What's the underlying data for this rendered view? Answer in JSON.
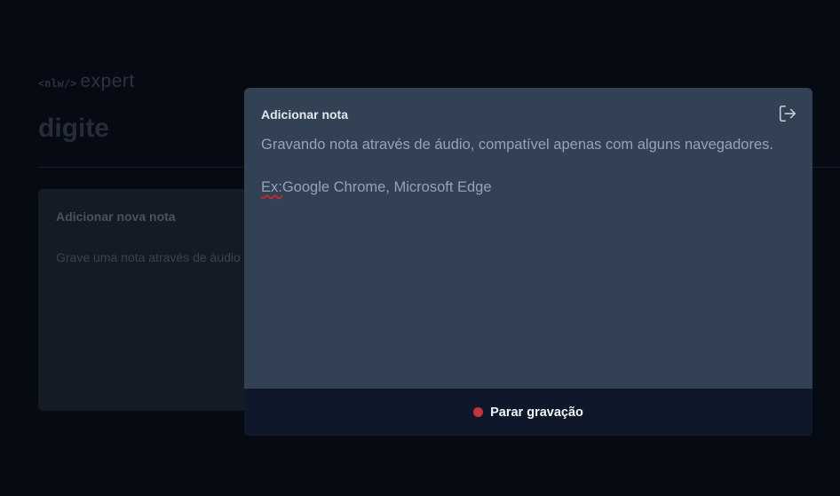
{
  "app": {
    "logo_code": "<nlw/>",
    "logo_word": "expert",
    "search_value": "digite"
  },
  "add_card": {
    "title": "Adicionar nova nota",
    "text": "Grave uma nota através de áudio ou utilize texto."
  },
  "modal": {
    "title": "Adicionar nota",
    "line1": "Gravando nota através de áudio, compatível apenas com alguns navegadores.",
    "ex_prefix": "Ex:",
    "ex_rest": "Google Chrome, Microsoft Edge",
    "close_icon": "exit-icon",
    "stop_label": "Parar gravação",
    "recording_color": "#c2353f"
  }
}
